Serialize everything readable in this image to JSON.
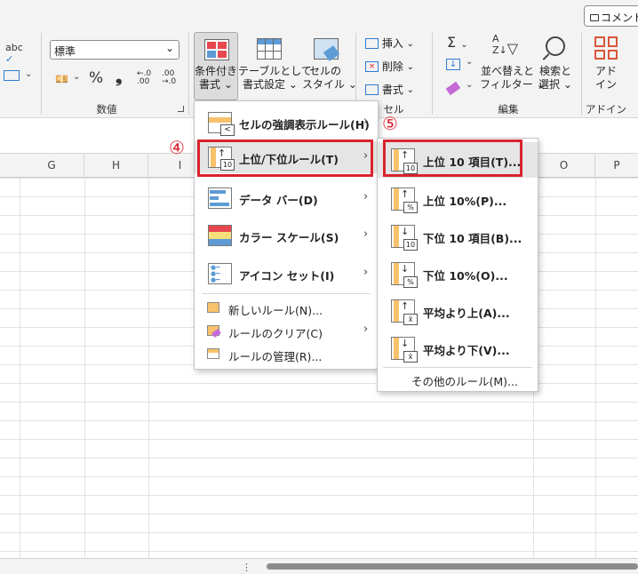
{
  "topbar": {
    "comment_button": "コメント"
  },
  "ribbon": {
    "number_format": {
      "selected": "標準"
    },
    "number_group_label": "数値",
    "conditional_format": {
      "line1": "条件付き",
      "line2": "書式"
    },
    "format_as_table": {
      "line1": "テーブルとして",
      "line2": "書式設定"
    },
    "cell_styles": {
      "line1": "セルの",
      "line2": "スタイル"
    },
    "cells": {
      "insert": "挿入",
      "delete": "削除",
      "format": "書式",
      "group_label": "セル"
    },
    "editing": {
      "sort_filter": {
        "line1": "並べ替えと",
        "line2": "フィルター"
      },
      "find_select": {
        "line1": "検索と",
        "line2": "選択"
      },
      "group_label": "編集"
    },
    "addin": {
      "line1": "アド",
      "line2": "イン",
      "group_label": "アドイン"
    }
  },
  "columns": [
    "G",
    "H",
    "I",
    "O",
    "P"
  ],
  "main_menu": {
    "items": [
      "セルの強調表示ルール(H)",
      "上位/下位ルール(T)",
      "データ バー(D)",
      "カラー スケール(S)",
      "アイコン セット(I)"
    ],
    "simple_items": [
      "新しいルール(N)...",
      "ルールのクリア(C)",
      "ルールの管理(R)..."
    ]
  },
  "sub_menu": {
    "items": [
      "上位 10 項目(T)...",
      "上位 10%(P)...",
      "下位 10 項目(B)...",
      "下位 10%(O)...",
      "平均より上(A)...",
      "平均より下(V)..."
    ],
    "more_rules": "その他のルール(M)..."
  },
  "annotations": {
    "step4": "④",
    "step5": "⑤"
  },
  "colors": {
    "highlight": "#d9232e"
  }
}
